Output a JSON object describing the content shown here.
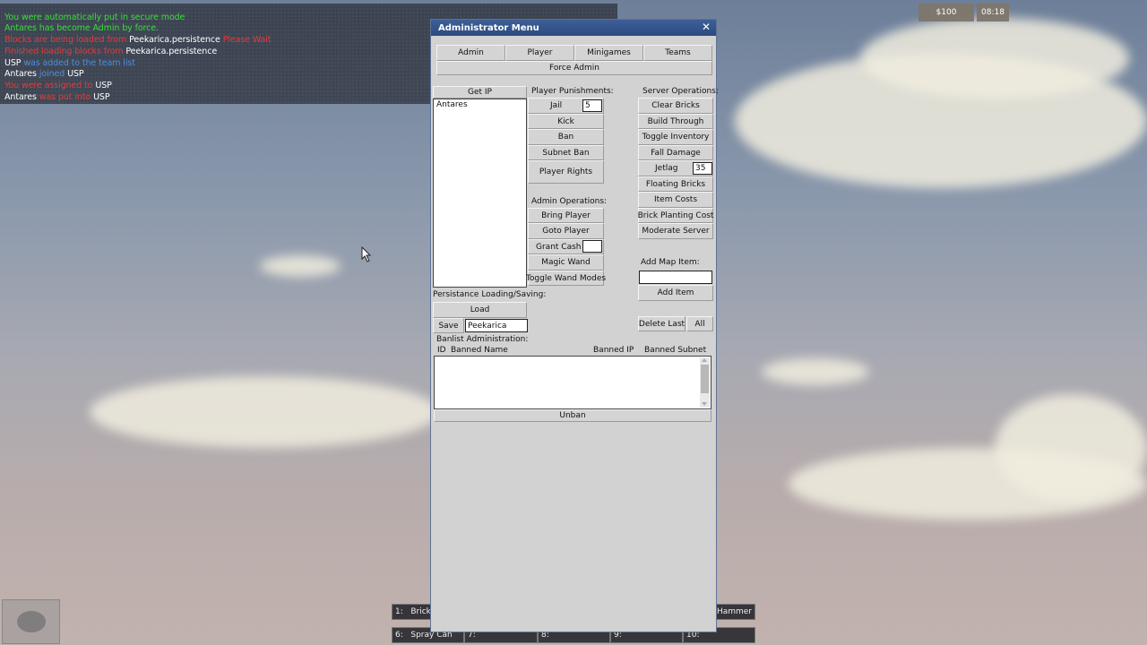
{
  "chat": {
    "lines": [
      {
        "parts": [
          {
            "text": "You were automatically put in secure mode",
            "color": "green"
          }
        ]
      },
      {
        "parts": [
          {
            "text": "Antares has become Admin by force.",
            "color": "green"
          }
        ]
      },
      {
        "parts": [
          {
            "text": "Blocks are being loaded from ",
            "color": "red"
          },
          {
            "text": "Peekarica.persistence",
            "color": "white"
          },
          {
            "text": " Please Wait",
            "color": "red"
          }
        ]
      },
      {
        "parts": [
          {
            "text": "Finished loading blocks from ",
            "color": "red"
          },
          {
            "text": "Peekarica.persistence",
            "color": "white"
          }
        ]
      },
      {
        "parts": [
          {
            "text": "USP",
            "color": "white"
          },
          {
            "text": " was added to the team list",
            "color": "blue"
          }
        ]
      },
      {
        "parts": [
          {
            "text": "Antares",
            "color": "white"
          },
          {
            "text": " joined ",
            "color": "blue"
          },
          {
            "text": "USP",
            "color": "white"
          }
        ]
      },
      {
        "parts": [
          {
            "text": "You were assigned to ",
            "color": "red"
          },
          {
            "text": "USP",
            "color": "white"
          }
        ]
      },
      {
        "parts": [
          {
            "text": "Antares",
            "color": "white"
          },
          {
            "text": " was put into ",
            "color": "red"
          },
          {
            "text": "USP",
            "color": "white"
          }
        ]
      }
    ]
  },
  "hud": {
    "cash": "$100",
    "clock": "08:18"
  },
  "admin_window": {
    "title": "Administrator Menu",
    "close_glyph": "✕",
    "tabs": [
      "Admin",
      "Player",
      "Minigames",
      "Teams"
    ],
    "force_admin": "Force Admin",
    "get_ip": "Get IP",
    "players": [
      "Antares"
    ],
    "punishments": {
      "heading": "Player Punishments:",
      "jail": "Jail",
      "jail_value": "5",
      "kick": "Kick",
      "ban": "Ban",
      "subnet_ban": "Subnet Ban",
      "player_rights": "Player Rights"
    },
    "admin_ops": {
      "heading": "Admin Operations:",
      "bring_player": "Bring Player",
      "goto_player": "Goto Player",
      "grant_cash": "Grant Cash",
      "grant_cash_value": "",
      "magic_wand": "Magic Wand",
      "toggle_wand_modes": "Toggle Wand Modes"
    },
    "server_ops": {
      "heading": "Server Operations:",
      "clear_bricks": "Clear Bricks",
      "build_through": "Build Through",
      "toggle_inventory": "Toggle Inventory",
      "fall_damage": "Fall Damage",
      "jetlag": "Jetlag",
      "jetlag_value": "35",
      "floating_bricks": "Floating Bricks",
      "item_costs": "Item Costs",
      "brick_planting_cost": "Brick Planting Cost",
      "moderate_server": "Moderate Server"
    },
    "map_item": {
      "heading": "Add Map Item:",
      "value": "",
      "add_item": "Add Item",
      "delete_last": "Delete Last",
      "all": "All"
    },
    "persistence": {
      "heading": "Persistance Loading/Saving:",
      "load": "Load",
      "save": "Save",
      "save_name": "Peekarica"
    },
    "banlist": {
      "heading": "Banlist Administration:",
      "columns": [
        "ID",
        "Banned Name",
        "Banned IP",
        "Banned Subnet"
      ],
      "rows": [],
      "unban": "Unban"
    }
  },
  "hotbar": {
    "slots": [
      {
        "label": "1:",
        "item": "Brick"
      },
      {
        "label": "5:",
        "item": "Hammer"
      },
      {
        "label": "6:",
        "item": "Spray Can"
      },
      {
        "label": "7:",
        "item": ""
      },
      {
        "label": "8:",
        "item": ""
      },
      {
        "label": "9:",
        "item": ""
      },
      {
        "label": "10:",
        "item": ""
      }
    ]
  }
}
